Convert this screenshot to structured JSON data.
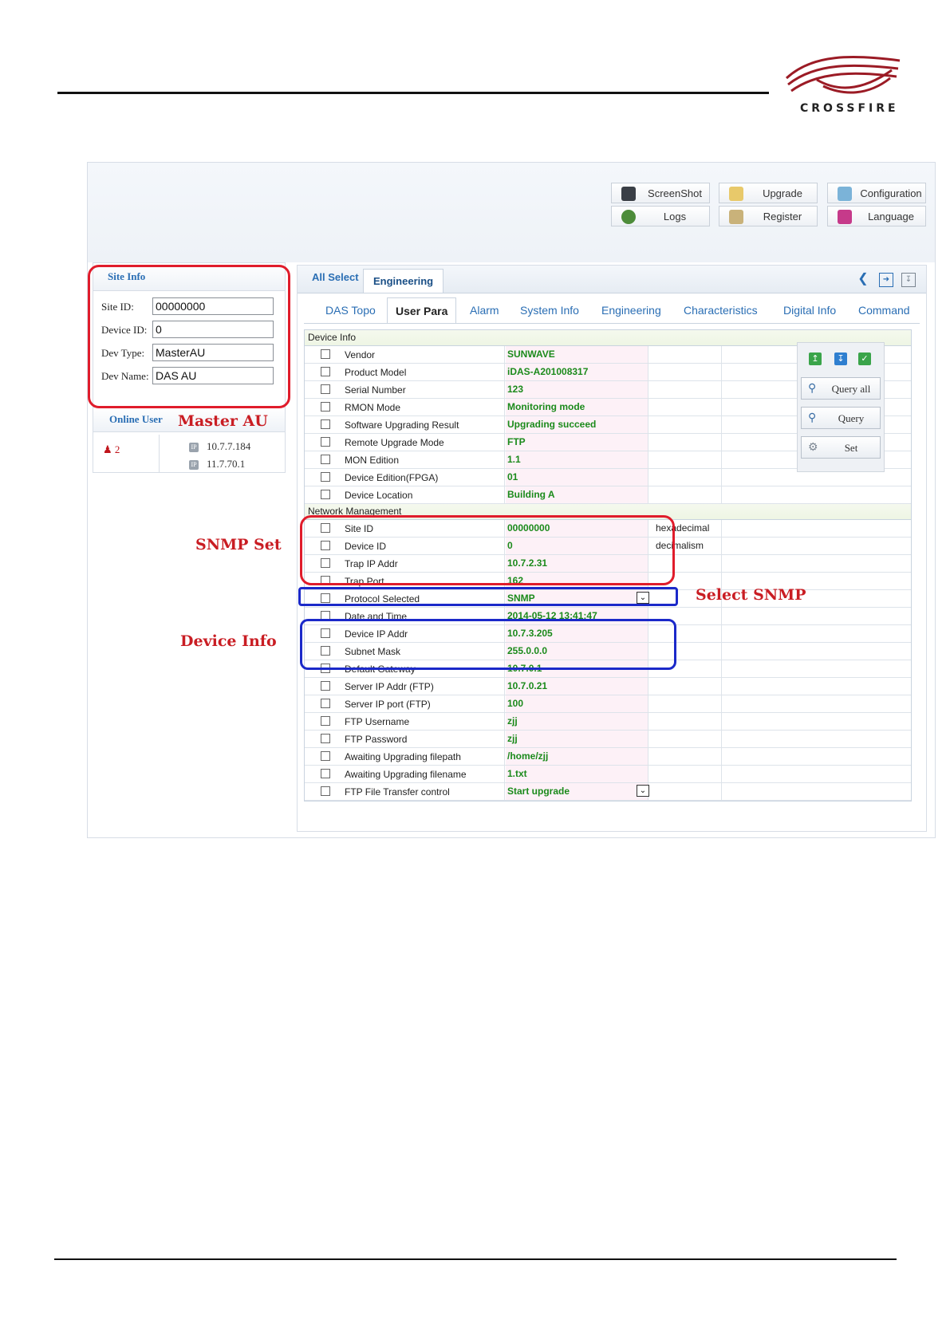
{
  "brand": {
    "logo_text": "CROSSFIRE"
  },
  "toolbar": [
    {
      "label": "ScreenShot",
      "icon": "camera-icon"
    },
    {
      "label": "Upgrade",
      "icon": "upgrade-icon"
    },
    {
      "label": "Configuration",
      "icon": "configuration-icon"
    },
    {
      "label": "Logs",
      "icon": "logs-icon"
    },
    {
      "label": "Register",
      "icon": "register-icon"
    },
    {
      "label": "Language",
      "icon": "language-icon"
    }
  ],
  "site_info": {
    "title": "Site Info",
    "fields": [
      {
        "label": "Site ID:",
        "value": "00000000"
      },
      {
        "label": "Device ID:",
        "value": "0"
      },
      {
        "label": "Dev Type:",
        "value": "MasterAU"
      },
      {
        "label": "Dev Name:",
        "value": "DAS AU"
      }
    ]
  },
  "online_user": {
    "title": "Online User",
    "count": "2",
    "ips": [
      "10.7.7.184",
      "11.7.70.1"
    ],
    "ip_badge": "IP"
  },
  "annotations": {
    "master_au": "Master AU",
    "snmp_set": "SNMP Set",
    "device_info": "Device Info",
    "select_snmp": "Select SNMP"
  },
  "top_tabs": [
    {
      "label": "All Select",
      "active": false
    },
    {
      "label": "Engineering",
      "active": true
    }
  ],
  "sub_tabs": [
    {
      "label": "DAS Topo",
      "active": false
    },
    {
      "label": "User Para",
      "active": true
    },
    {
      "label": "Alarm",
      "active": false
    },
    {
      "label": "System Info",
      "active": false
    },
    {
      "label": "Engineering",
      "active": false
    },
    {
      "label": "Characteristics",
      "active": false
    },
    {
      "label": "Digital Info",
      "active": false
    },
    {
      "label": "Command",
      "active": false
    }
  ],
  "actions": {
    "query_all": "Query all",
    "query": "Query",
    "set": "Set"
  },
  "sections": [
    {
      "title": "Device Info",
      "rows": [
        {
          "name": "Vendor",
          "value": "SUNWAVE"
        },
        {
          "name": "Product Model",
          "value": "iDAS-A201008317"
        },
        {
          "name": "Serial Number",
          "value": "123"
        },
        {
          "name": "RMON Mode",
          "value": "Monitoring mode"
        },
        {
          "name": "Software Upgrading Result",
          "value": "Upgrading succeed"
        },
        {
          "name": "Remote Upgrade Mode",
          "value": "FTP"
        },
        {
          "name": "MON Edition",
          "value": "1.1"
        },
        {
          "name": "Device Edition(FPGA)",
          "value": "01"
        },
        {
          "name": "Device Location",
          "value": "Building A"
        }
      ]
    },
    {
      "title": "Network Management",
      "rows": [
        {
          "name": "Site ID",
          "value": "00000000",
          "unit": "hexadecimal"
        },
        {
          "name": "Device ID",
          "value": "0",
          "unit": "decimalism"
        },
        {
          "name": "Trap IP Addr",
          "value": "10.7.2.31"
        },
        {
          "name": "Trap Port",
          "value": "162"
        },
        {
          "name": "Protocol Selected",
          "value": "SNMP",
          "dropdown": true
        },
        {
          "name": "Date and Time",
          "value": "2014-05-12 13:41:47"
        },
        {
          "name": "Device IP Addr",
          "value": "10.7.3.205"
        },
        {
          "name": "Subnet Mask",
          "value": "255.0.0.0"
        },
        {
          "name": "Default Gateway",
          "value": "10.7.0.1"
        },
        {
          "name": "Server IP Addr (FTP)",
          "value": "10.7.0.21"
        },
        {
          "name": "Server IP port (FTP)",
          "value": "100"
        },
        {
          "name": "FTP Username",
          "value": "zjj"
        },
        {
          "name": "FTP Password",
          "value": "zjj"
        },
        {
          "name": "Awaiting Upgrading filepath",
          "value": "/home/zjj"
        },
        {
          "name": "Awaiting Upgrading filename",
          "value": "1.txt"
        },
        {
          "name": "FTP File Transfer control",
          "value": "Start upgrade",
          "dropdown": true
        }
      ]
    }
  ]
}
